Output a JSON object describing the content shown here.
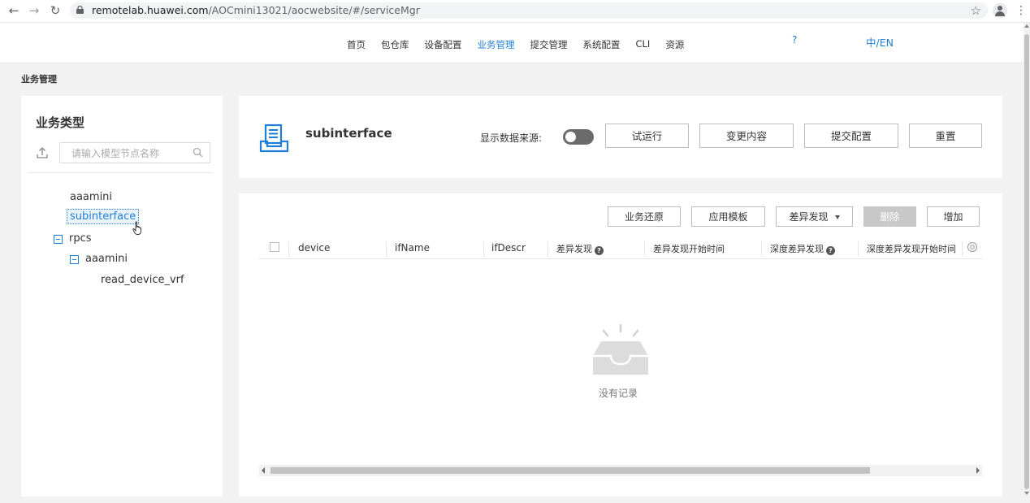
{
  "browser": {
    "url_host": "remotelab.huawei.com",
    "url_path": "/AOCmini13021/aocwebsite/#/serviceMgr"
  },
  "topnav": {
    "items": [
      "首页",
      "包仓库",
      "设备配置",
      "业务管理",
      "提交管理",
      "系统配置",
      "CLI",
      "资源"
    ],
    "active": "业务管理",
    "help": "?",
    "lang": "中/EN"
  },
  "breadcrumb": "业务管理",
  "sidebar": {
    "title": "业务类型",
    "search_placeholder": "请输入模型节点名称",
    "tree": {
      "aaamini": "aaamini",
      "subinterface": "subinterface",
      "rpcs": "rpcs",
      "rpcs_aaamini": "aaamini",
      "read_device_vrf": "read_device_vrf"
    },
    "selected": "subinterface"
  },
  "service": {
    "title": "subinterface",
    "datasource_label": "显示数据来源:",
    "datasource_on": false,
    "buttons": {
      "trial_run": "试运行",
      "change_content": "变更内容",
      "submit_config": "提交配置",
      "reset": "重置"
    }
  },
  "table": {
    "actions": {
      "restore": "业务还原",
      "apply_template": "应用模板",
      "diff_discovery": "差异发现",
      "delete": "删除",
      "add": "增加"
    },
    "columns": [
      "device",
      "ifName",
      "ifDescr",
      "差异发现",
      "差异发现开始时间",
      "深度差异发现",
      "深度差异发现开始时间"
    ],
    "empty_text": "没有记录"
  }
}
